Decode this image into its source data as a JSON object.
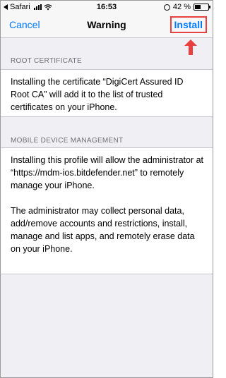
{
  "status_bar": {
    "carrier": "Safari",
    "time": "16:53",
    "battery_percent": "42 %",
    "battery_level": 0.42
  },
  "nav": {
    "cancel_label": "Cancel",
    "title": "Warning",
    "install_label": "Install"
  },
  "sections": {
    "root_certificate": {
      "header": "ROOT CERTIFICATE",
      "text": "Installing the certificate “DigiCert Assured ID Root CA” will add it to the list of trusted certificates on your iPhone."
    },
    "mdm": {
      "header": "MOBILE DEVICE MANAGEMENT",
      "paragraph1": "Installing this profile will allow the administrator at “https://mdm-ios.bitdefender.net” to remotely manage your iPhone.",
      "paragraph2": "The administrator may collect personal data, add/remove accounts and restrictions, install, manage and list apps, and remotely erase data on your iPhone."
    }
  },
  "colors": {
    "accent": "#007aff",
    "highlight": "#e8413f"
  }
}
